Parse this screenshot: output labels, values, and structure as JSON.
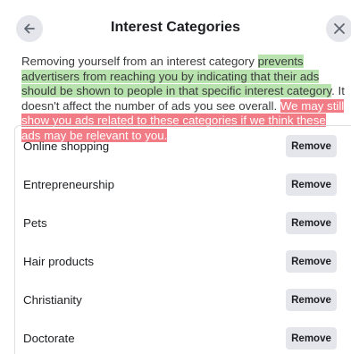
{
  "header": {
    "title": "Interest Categories",
    "back_icon": "arrow-left-icon",
    "close_icon": "close-icon"
  },
  "description": {
    "part1": "Removing yourself from an interest category ",
    "part2_green": "prevents advertisers from reaching you by indicating that their ads should be shown to people in that specific interest category",
    "part3": ". It doesn't affect the number of ads you see overall. ",
    "part4_red": "We may still show you ads related to these categories if we think these ads may be relevant to you."
  },
  "categories": [
    {
      "label": "Online shopping",
      "button": "Remove"
    },
    {
      "label": "Entrepreneurship",
      "button": "Remove"
    },
    {
      "label": "Pets",
      "button": "Remove"
    },
    {
      "label": "Hair products",
      "button": "Remove"
    },
    {
      "label": "Christianity",
      "button": "Remove"
    },
    {
      "label": "Doctorate",
      "button": "Remove"
    }
  ],
  "colors": {
    "highlight_green": "#b9e3ae",
    "highlight_red": "#f17c86",
    "button_bg": "#e4e6eb"
  }
}
